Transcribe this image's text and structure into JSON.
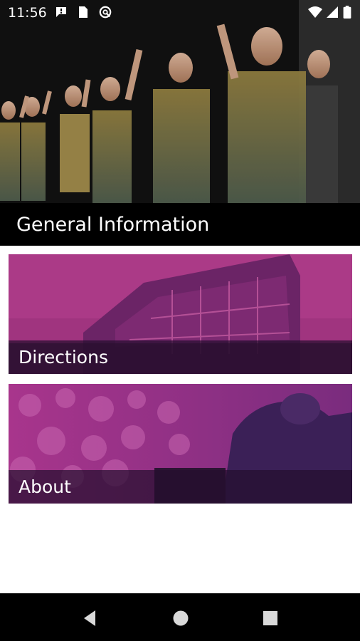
{
  "status_bar": {
    "time": "11:56",
    "left_icons": [
      "message-icon",
      "sim-card-icon",
      "sync-icon"
    ],
    "right_icons": [
      "wifi-icon",
      "signal-icon",
      "battery-icon"
    ]
  },
  "header": {
    "title": "General Information",
    "image": "kapa-haka-performers-photo"
  },
  "cards": [
    {
      "label": "Directions",
      "image": "university-building-photo",
      "tint": "#9b2c7f"
    },
    {
      "label": "About",
      "image": "audience-crowd-photo",
      "tint": "#8a2a80"
    }
  ],
  "nav_bar": {
    "buttons": [
      "back-icon",
      "home-icon",
      "recents-icon"
    ]
  }
}
